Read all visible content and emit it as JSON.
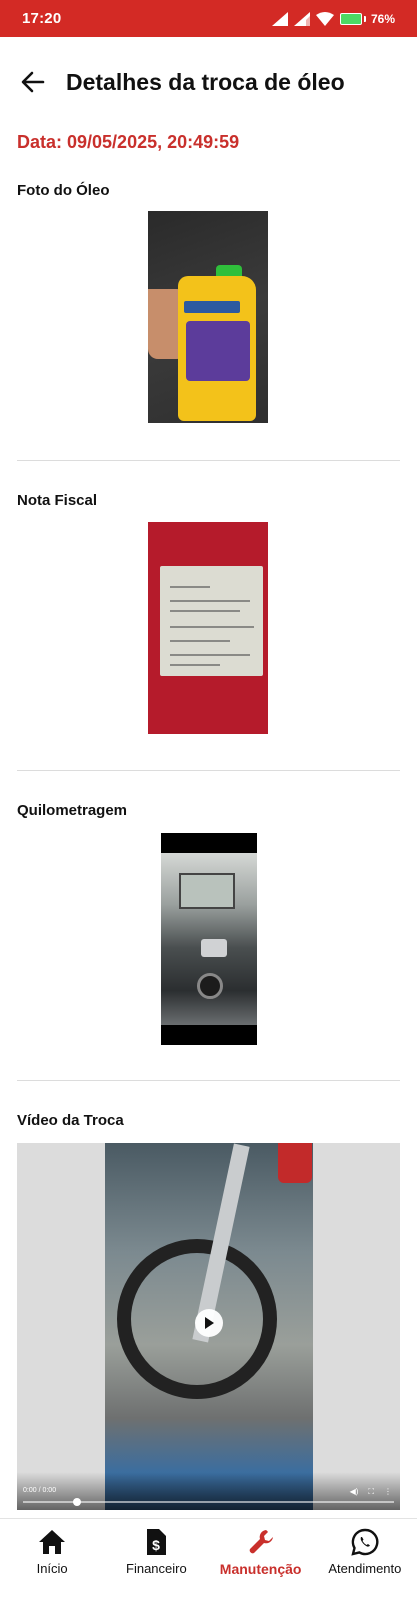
{
  "status_bar": {
    "time": "17:20",
    "battery_percent": "76",
    "battery_suffix": "%"
  },
  "header": {
    "title": "Detalhes da troca de óleo",
    "back_icon": "arrow-left-icon"
  },
  "date_label": "Data: 09/05/2025, 20:49:59",
  "sections": {
    "oil_photo": {
      "title": "Foto do Óleo"
    },
    "invoice": {
      "title": "Nota Fiscal"
    },
    "mileage": {
      "title": "Quilometragem"
    },
    "video": {
      "title": "Vídeo da Troca",
      "time_display": "0:00 / 0:00"
    }
  },
  "bottom_nav": {
    "items": [
      {
        "label": "Início",
        "icon": "home-icon",
        "active": false
      },
      {
        "label": "Financeiro",
        "icon": "money-document-icon",
        "active": false
      },
      {
        "label": "Manutenção",
        "icon": "wrench-icon",
        "active": true
      },
      {
        "label": "Atendimento",
        "icon": "whatsapp-icon",
        "active": false
      }
    ]
  },
  "colors": {
    "primary": "#d32a25",
    "accent_text": "#c9302c"
  }
}
